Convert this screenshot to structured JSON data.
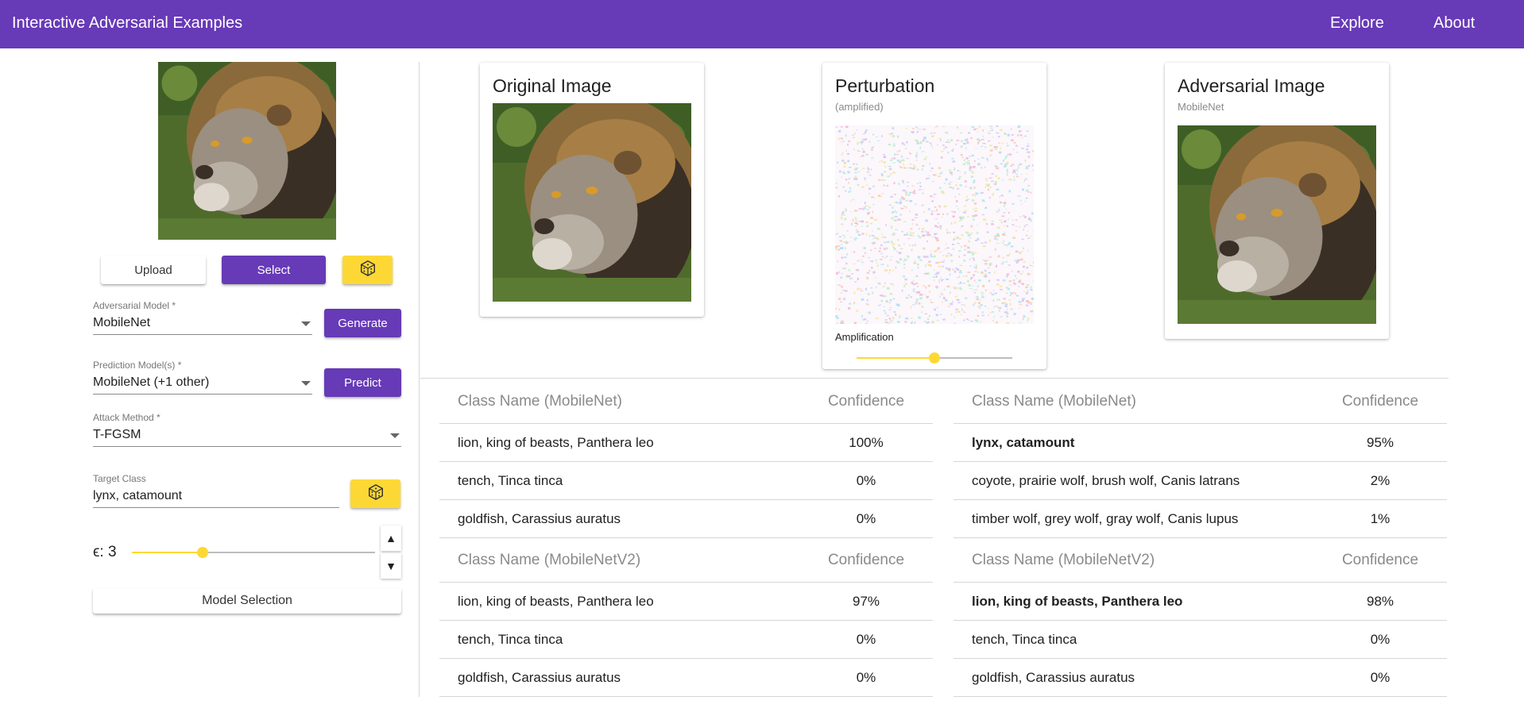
{
  "app": {
    "title": "Interactive Adversarial Examples"
  },
  "nav": {
    "explore": "Explore",
    "about": "About"
  },
  "left": {
    "upload_label": "Upload",
    "select_label": "Select",
    "random_icon": "dice-icon",
    "adversarial_model": {
      "label": "Adversarial Model *",
      "value": "MobileNet"
    },
    "generate_label": "Generate",
    "prediction_models": {
      "label": "Prediction Model(s) *",
      "value": "MobileNet (+1 other)"
    },
    "predict_label": "Predict",
    "attack_method": {
      "label": "Attack Method *",
      "value": "T-FGSM"
    },
    "target_class": {
      "label": "Target Class",
      "value": "lynx, catamount"
    },
    "epsilon": {
      "label": "ϵ: 3",
      "fraction": 0.29
    },
    "stepper_up": "▲",
    "stepper_down": "▼",
    "model_selection_label": "Model Selection"
  },
  "cards": {
    "original": {
      "title": "Original Image"
    },
    "perturbation": {
      "title": "Perturbation",
      "subtitle": "(amplified)",
      "amplification_label": "Amplification",
      "amplification_fraction": 0.5
    },
    "adversarial": {
      "title": "Adversarial Image",
      "subtitle": "MobileNet"
    }
  },
  "colors": {
    "primary": "#673ab7",
    "accent": "#fdd835",
    "success": "#2eaa1f",
    "error": "#e21b1b"
  },
  "original_predictions": [
    {
      "header_class": "Class Name (MobileNet)",
      "header_conf": "Confidence",
      "rows": [
        {
          "name": "lion, king of beasts, Panthera leo",
          "conf": "100%"
        },
        {
          "name": "tench, Tinca tinca",
          "conf": "0%"
        },
        {
          "name": "goldfish, Carassius auratus",
          "conf": "0%"
        }
      ]
    },
    {
      "header_class": "Class Name (MobileNetV2)",
      "header_conf": "Confidence",
      "rows": [
        {
          "name": "lion, king of beasts, Panthera leo",
          "conf": "97%"
        },
        {
          "name": "tench, Tinca tinca",
          "conf": "0%"
        },
        {
          "name": "goldfish, Carassius auratus",
          "conf": "0%"
        }
      ]
    }
  ],
  "adversarial_predictions": [
    {
      "header_class": "Class Name (MobileNet)",
      "header_conf": "Confidence",
      "rows": [
        {
          "name": "lynx, catamount",
          "conf": "95%",
          "highlight": "green"
        },
        {
          "name": "coyote, prairie wolf, brush wolf, Canis latrans",
          "conf": "2%"
        },
        {
          "name": "timber wolf, grey wolf, gray wolf, Canis lupus",
          "conf": "1%"
        }
      ]
    },
    {
      "header_class": "Class Name (MobileNetV2)",
      "header_conf": "Confidence",
      "rows": [
        {
          "name": "lion, king of beasts, Panthera leo",
          "conf": "98%",
          "highlight": "red"
        },
        {
          "name": "tench, Tinca tinca",
          "conf": "0%"
        },
        {
          "name": "goldfish, Carassius auratus",
          "conf": "0%"
        }
      ]
    }
  ]
}
